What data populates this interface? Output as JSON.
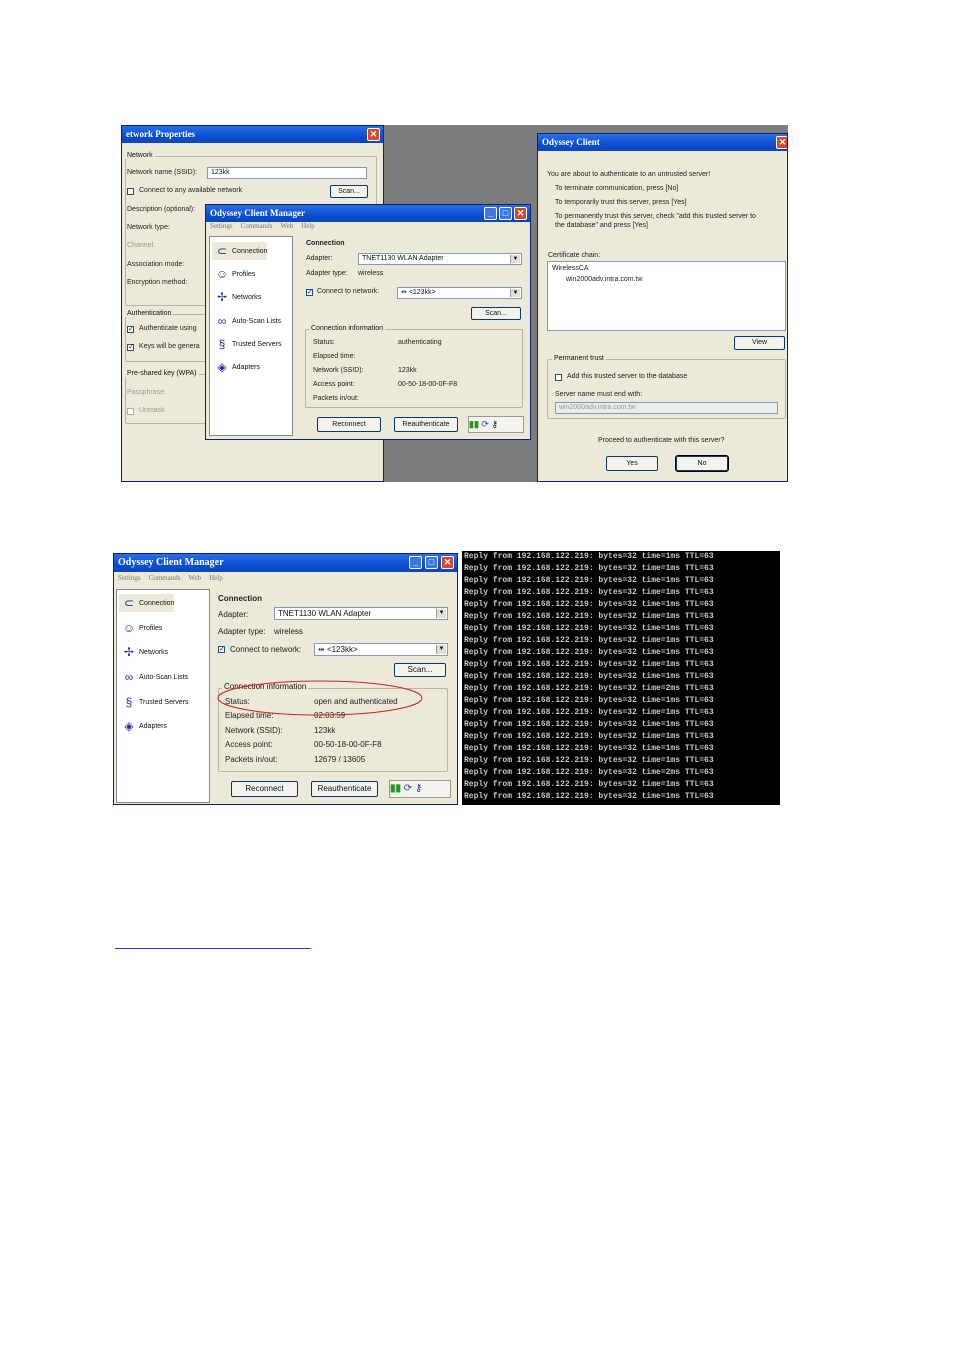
{
  "np": {
    "title": "etwork Properties",
    "network_group": "Network",
    "ssid_label": "Network name (SSID):",
    "ssid_value": "123kk",
    "connect_any": "Connect to any available network",
    "scan": "Scan...",
    "description_label": "Description (optional):",
    "network_type_label": "Network type:",
    "channel_label": "Channel:",
    "association_label": "Association mode:",
    "encryption_label": "Encryption method:",
    "auth_group": "Authentication",
    "auth_using": "Authenticate using",
    "keys_generated": "Keys will be genera",
    "psk_group": "Pre-shared key (WPA)",
    "passphrase_label": "Passphrase:",
    "unmask_label": "Unmask"
  },
  "ocm1": {
    "title": "Odyssey Client Manager",
    "menu": [
      "Settings",
      "Commands",
      "Web",
      "Help"
    ],
    "nav": [
      "Connection",
      "Profiles",
      "Networks",
      "Auto-Scan Lists",
      "Trusted Servers",
      "Adapters"
    ],
    "nav_icons": [
      "connection-icon",
      "profiles-icon",
      "networks-icon",
      "auto-scan-icon",
      "trusted-servers-icon",
      "adapters-icon"
    ],
    "heading": "Connection",
    "adapter_label": "Adapter:",
    "adapter_value": "TNET1130 WLAN Adapter",
    "adapter_type_label": "Adapter type:",
    "adapter_type_value": "wireless",
    "connect_label": "Connect to network:",
    "network_value": "<123kk>",
    "scan": "Scan...",
    "info_group": "Connection information",
    "rows": [
      {
        "k": "Status:",
        "v": "authenticating"
      },
      {
        "k": "Elapsed time:",
        "v": ""
      },
      {
        "k": "Network (SSID):",
        "v": "123kk"
      },
      {
        "k": "Access point:",
        "v": "00-50-18-00-0F-F8"
      },
      {
        "k": "Packets in/out:",
        "v": ""
      }
    ],
    "reconnect": "Reconnect",
    "reauthenticate": "Reauthenticate"
  },
  "oc": {
    "title": "Odyssey Client",
    "intro": "You are about to authenticate to an untrusted server!",
    "line1": "To terminate communication, press [No]",
    "line2": "To temporarily trust this server, press [Yes]",
    "line3a": "To permanently trust this server, check \"add this trusted server to",
    "line3b": "the database\" and press [Yes]",
    "cert_label": "Certificate chain:",
    "cert_root": "WirelessCA",
    "cert_child": "win2000adv.intra.com.tw",
    "view": "View",
    "perm_group": "Permanent trust",
    "add_trusted": "Add this trusted server to the database",
    "server_end_label": "Server name must end with:",
    "server_end_value": "win2000adv.intra.com.tw",
    "question": "Proceed to authenticate with this server?",
    "yes": "Yes",
    "no": "No"
  },
  "ocm2": {
    "title": "Odyssey Client Manager",
    "menu": [
      "Settings",
      "Commands",
      "Web",
      "Help"
    ],
    "nav": [
      "Connection",
      "Profiles",
      "Networks",
      "Auto-Scan Lists",
      "Trusted Servers",
      "Adapters"
    ],
    "nav_icons": [
      "connection-icon",
      "profiles-icon",
      "networks-icon",
      "auto-scan-icon",
      "trusted-servers-icon",
      "adapters-icon"
    ],
    "heading": "Connection",
    "adapter_label": "Adapter:",
    "adapter_value": "TNET1130 WLAN Adapter",
    "adapter_type_label": "Adapter type:",
    "adapter_type_value": "wireless",
    "connect_label": "Connect to network:",
    "network_value": "<123kk>",
    "scan": "Scan...",
    "info_group": "Connection information",
    "rows": [
      {
        "k": "Status:",
        "v": "open and authenticated"
      },
      {
        "k": "Elapsed time:",
        "v": "02:03:59"
      },
      {
        "k": "Network (SSID):",
        "v": "123kk"
      },
      {
        "k": "Access point:",
        "v": "00-50-18-00-0F-F8"
      },
      {
        "k": "Packets in/out:",
        "v": "12679 / 13605"
      }
    ],
    "reconnect": "Reconnect",
    "reauthenticate": "Reauthenticate",
    "highlight_color": "#d0211b"
  },
  "terminal": {
    "lines": [
      "Reply from 192.168.122.219: bytes=32 time=1ms TTL=63",
      "Reply from 192.168.122.219: bytes=32 time=1ms TTL=63",
      "Reply from 192.168.122.219: bytes=32 time=1ms TTL=63",
      "Reply from 192.168.122.219: bytes=32 time=1ms TTL=63",
      "Reply from 192.168.122.219: bytes=32 time=1ms TTL=63",
      "Reply from 192.168.122.219: bytes=32 time=1ms TTL=63",
      "Reply from 192.168.122.219: bytes=32 time=1ms TTL=63",
      "Reply from 192.168.122.219: bytes=32 time=1ms TTL=63",
      "Reply from 192.168.122.219: bytes=32 time=1ms TTL=63",
      "Reply from 192.168.122.219: bytes=32 time=1ms TTL=63",
      "Reply from 192.168.122.219: bytes=32 time=1ms TTL=63",
      "Reply from 192.168.122.219: bytes=32 time=2ms TTL=63",
      "Reply from 192.168.122.219: bytes=32 time=1ms TTL=63",
      "Reply from 192.168.122.219: bytes=32 time=1ms TTL=63",
      "Reply from 192.168.122.219: bytes=32 time=1ms TTL=63",
      "Reply from 192.168.122.219: bytes=32 time=1ms TTL=63",
      "Reply from 192.168.122.219: bytes=32 time=1ms TTL=63",
      "Reply from 192.168.122.219: bytes=32 time=1ms TTL=63",
      "Reply from 192.168.122.219: bytes=32 time=2ms TTL=63",
      "Reply from 192.168.122.219: bytes=32 time=1ms TTL=63",
      "Reply from 192.168.122.219: bytes=32 time=1ms TTL=63"
    ]
  }
}
